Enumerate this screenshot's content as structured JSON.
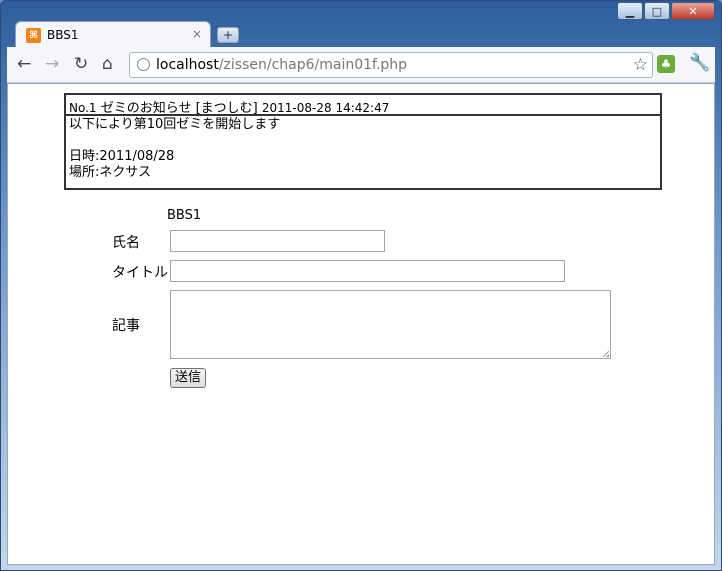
{
  "browser": {
    "tab_title": "BBS1",
    "tab_close": "×",
    "new_tab": "+",
    "url_host": "localhost",
    "url_path": "/zissen/chap6/main01f.php"
  },
  "message": {
    "no": "No.1",
    "subject": "ゼミのお知らせ",
    "author": "[まつしむ]",
    "datetime": "2011-08-28 14:42:47",
    "body_lines": [
      "以下により第10回ゼミを開始します",
      "",
      "日時:2011/08/28",
      "場所:ネクサス"
    ]
  },
  "form": {
    "title": "BBS1",
    "name_label": "氏名",
    "title_label": "タイトル",
    "body_label": "記事",
    "name_value": "",
    "title_value": "",
    "body_value": "",
    "submit_label": "送信"
  }
}
